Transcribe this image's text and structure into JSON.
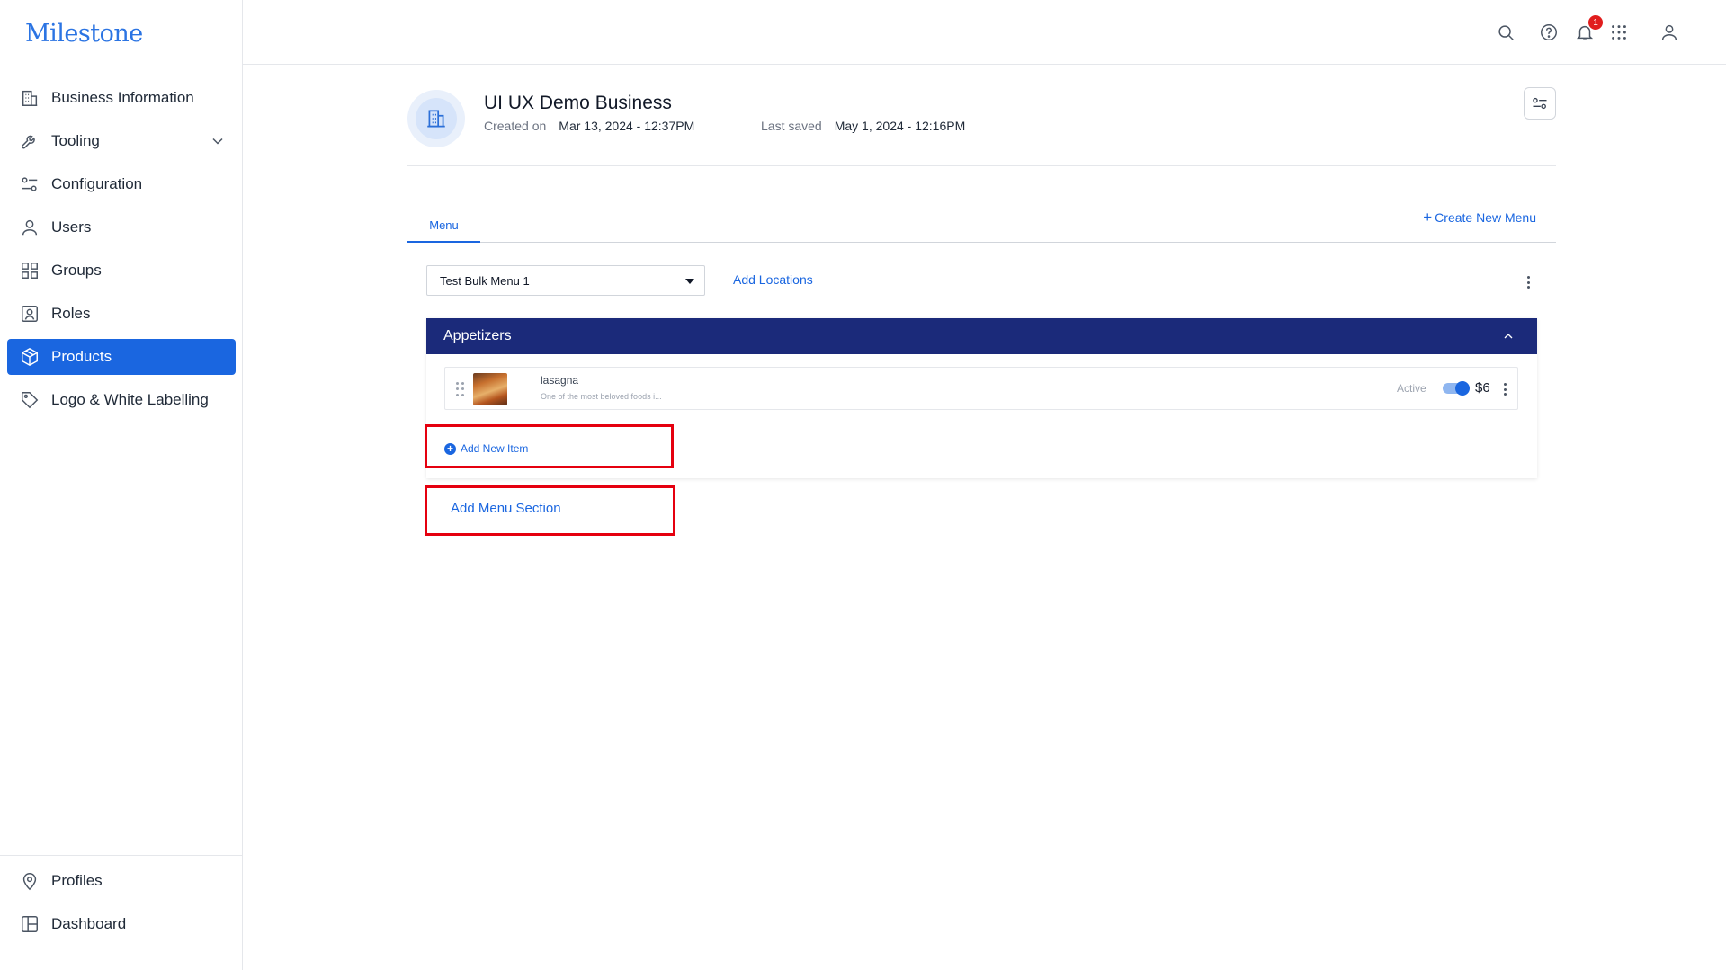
{
  "brand": {
    "logo_text": "Milestone",
    "accent": "#1a66e0",
    "section_header_bg": "#1b2a7a"
  },
  "sidebar": {
    "items": [
      {
        "label": "Business Information",
        "icon": "building-icon"
      },
      {
        "label": "Tooling",
        "icon": "wrench-icon",
        "expandable": true
      },
      {
        "label": "Configuration",
        "icon": "sliders-icon"
      },
      {
        "label": "Users",
        "icon": "user-icon"
      },
      {
        "label": "Groups",
        "icon": "grid-icon"
      },
      {
        "label": "Roles",
        "icon": "id-badge-icon"
      },
      {
        "label": "Products",
        "icon": "box-icon",
        "active": true
      },
      {
        "label": "Logo & White Labelling",
        "icon": "tag-icon"
      }
    ],
    "bottom_items": [
      {
        "label": "Profiles",
        "icon": "map-pin-icon"
      },
      {
        "label": "Dashboard",
        "icon": "dashboard-icon"
      }
    ]
  },
  "topbar": {
    "icons": [
      "search-icon",
      "help-icon",
      "bell-icon",
      "apps-grid-icon",
      "account-icon"
    ],
    "notification_count": "1"
  },
  "business": {
    "name": "UI UX Demo Business",
    "created_label": "Created on",
    "created_value": "Mar 13, 2024 - 12:37PM",
    "saved_label": "Last saved",
    "saved_value": "May 1, 2024 - 12:16PM"
  },
  "tabs": [
    {
      "label": "Menu",
      "active": true
    }
  ],
  "create_menu_label": "Create New Menu",
  "menu_select": {
    "selected": "Test Bulk Menu 1"
  },
  "add_locations_label": "Add Locations",
  "section": {
    "title": "Appetizers",
    "items": [
      {
        "name": "lasagna",
        "description": "One of the most beloved foods i...",
        "status": "Active",
        "active": true,
        "price": "$6"
      }
    ],
    "add_item_label": "Add New Item"
  },
  "add_section_label": "Add Menu Section"
}
